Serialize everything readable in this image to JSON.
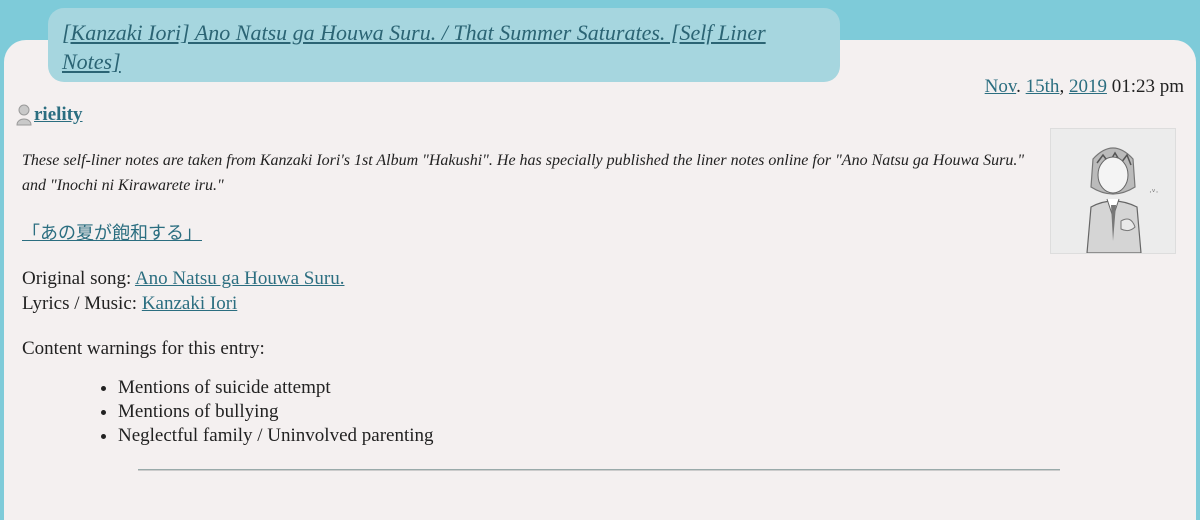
{
  "entry": {
    "title": "[Kanzaki Iori] Ano Natsu ga Houwa Suru. / That Summer Saturates. [Self Liner Notes]",
    "date": {
      "month": "Nov",
      "sep1": ". ",
      "day": "15th",
      "sep2": ", ",
      "year": "2019",
      "time": " 01:23 pm"
    },
    "user": {
      "name": "rielity",
      "icon": "user-icon"
    },
    "avatar": {
      "icon": "avatar-image"
    },
    "intro": "These self-liner notes are taken from Kanzaki Iori's 1st Album \"Hakushi\". He has specially published the liner notes online for \"Ano Natsu ga Houwa Suru.\" and \"Inochi ni Kirawarete iru.\"",
    "jp_link": "「あの夏が飽和する」",
    "original_song_label": "Original song: ",
    "original_song_value": "Ano Natsu ga Houwa Suru.",
    "lyrics_label": "Lyrics / Music: ",
    "lyrics_value": "Kanzaki Iori",
    "content_warnings_title": "Content warnings for this entry:",
    "content_warnings": [
      "Mentions of suicide attempt",
      "Mentions of bullying",
      "Neglectful family / Uninvolved parenting"
    ]
  },
  "colors": {
    "background": "#7ecbd9",
    "panel": "#f4f0f0",
    "title_box": "#a6d6df",
    "link": "#2b6e80"
  }
}
